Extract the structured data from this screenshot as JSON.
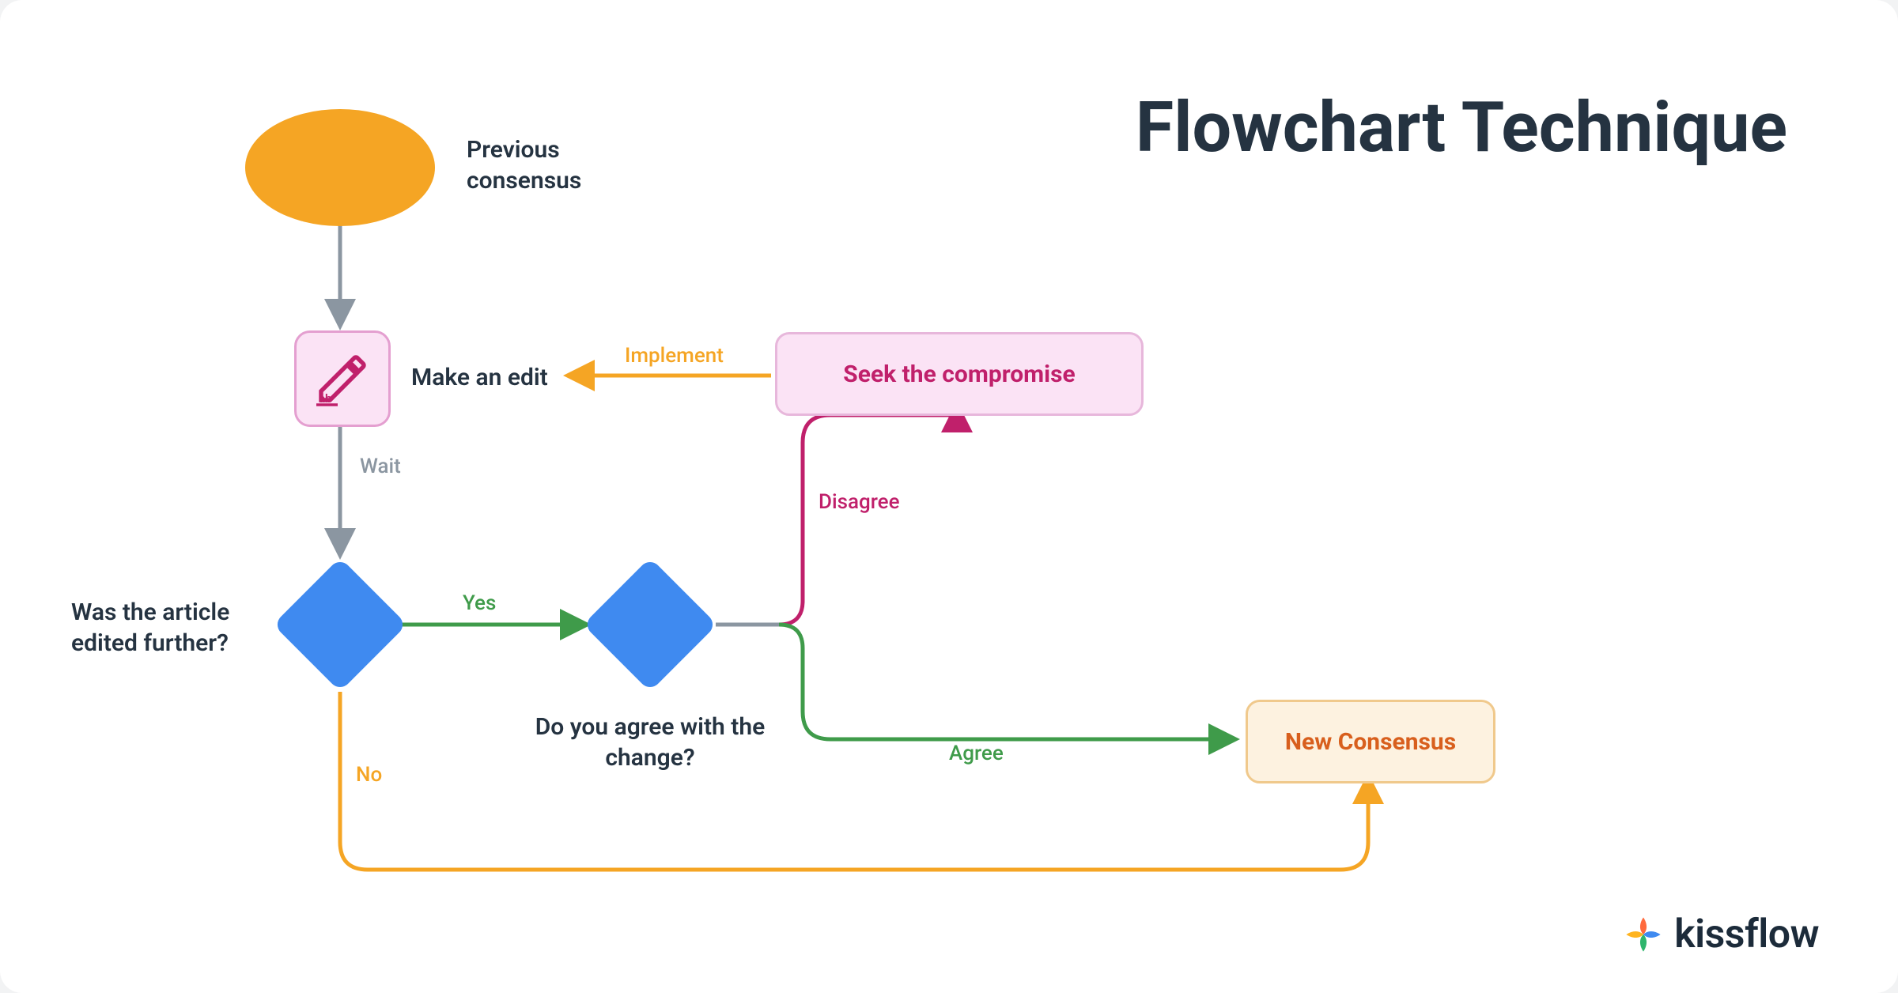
{
  "title": "Flowchart Technique",
  "nodes": {
    "start": {
      "label": "Previous consensus"
    },
    "edit": {
      "label": "Make an edit"
    },
    "decision1": {
      "label": "Was the article edited further?"
    },
    "decision2": {
      "label": "Do you agree with the change?"
    },
    "compromise": {
      "label": "Seek the compromise"
    },
    "newConsensus": {
      "label": "New Consensus"
    }
  },
  "edges": {
    "wait": "Wait",
    "yes": "Yes",
    "no": "No",
    "implement": "Implement",
    "disagree": "Disagree",
    "agree": "Agree"
  },
  "colors": {
    "orange": "#f5a524",
    "blue": "#3f8af0",
    "pinkFill": "#fbe3f5",
    "pinkBorder": "#e49fd0",
    "magentaText": "#c0206b",
    "orangeFill": "#fdf2e0",
    "orangeBorder": "#f0c98c",
    "orangeText": "#d85f1d",
    "green": "#3f9b4a",
    "magentaLine": "#c0206b",
    "orangeLine": "#f5a524",
    "gray": "#8b96a1",
    "dark": "#253341"
  },
  "brand": "kissflow"
}
